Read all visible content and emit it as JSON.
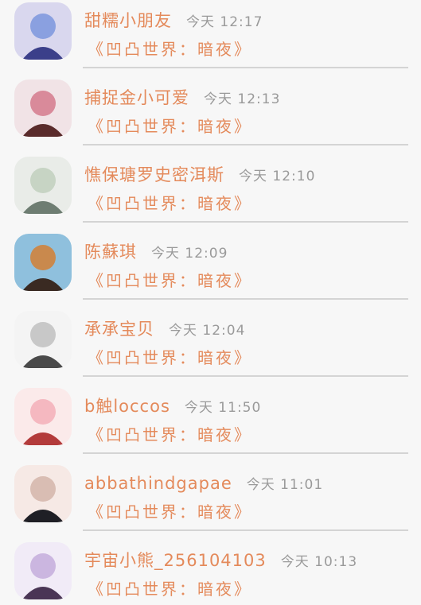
{
  "conversations": [
    {
      "name": "甜糯小朋友",
      "time": "今天 12:17",
      "message": "《凹凸世界：暗夜》",
      "avatar_colors": [
        "#3b3f8a",
        "#8aa0e0",
        "#d9d7ee"
      ]
    },
    {
      "name": "捕捉金小可爱",
      "time": "今天 12:13",
      "message": "《凹凸世界：暗夜》",
      "avatar_colors": [
        "#5a2b2b",
        "#d98a9a",
        "#f1e3e6"
      ]
    },
    {
      "name": "憔保瑭罗史密洱斯",
      "time": "今天 12:10",
      "message": "《凹凸世界：暗夜》",
      "avatar_colors": [
        "#6e7d72",
        "#c7d4c4",
        "#e9ece8"
      ]
    },
    {
      "name": "陈蘇琪",
      "time": "今天 12:09",
      "message": "《凹凸世界：暗夜》",
      "avatar_colors": [
        "#3a2a22",
        "#c9894d",
        "#8fc0dd"
      ]
    },
    {
      "name": "承承宝贝",
      "time": "今天 12:04",
      "message": "《凹凸世界：暗夜》",
      "avatar_colors": [
        "#4a4a4a",
        "#c8c8c8",
        "#f4f4f4"
      ]
    },
    {
      "name": "b触loccos",
      "time": "今天 11:50",
      "message": "《凹凸世界：暗夜》",
      "avatar_colors": [
        "#b33b3b",
        "#f5b8c0",
        "#fbeaea"
      ]
    },
    {
      "name": "abbathindgapae",
      "time": "今天 11:01",
      "message": "《凹凸世界：暗夜》",
      "avatar_colors": [
        "#1f1f25",
        "#d9bdb3",
        "#f6e9e5"
      ]
    },
    {
      "name": "宇宙小熊_256104103",
      "time": "今天 10:13",
      "message": "《凹凸世界：暗夜》",
      "avatar_colors": [
        "#4a3555",
        "#cbb6e0",
        "#f1ebf7"
      ]
    }
  ]
}
